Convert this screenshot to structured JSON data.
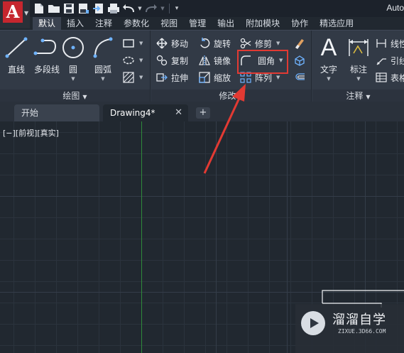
{
  "app": {
    "title": "Auto",
    "logo_letter": "A"
  },
  "ribbon_tabs": [
    {
      "label": "默认",
      "active": true
    },
    {
      "label": "插入"
    },
    {
      "label": "注释"
    },
    {
      "label": "参数化"
    },
    {
      "label": "视图"
    },
    {
      "label": "管理"
    },
    {
      "label": "输出"
    },
    {
      "label": "附加模块"
    },
    {
      "label": "协作"
    },
    {
      "label": "精选应用"
    }
  ],
  "draw_panel": {
    "title": "绘图",
    "tools": {
      "line": "直线",
      "polyline": "多段线",
      "circle": "圆",
      "arc": "圆弧"
    }
  },
  "modify_panel": {
    "title": "修改",
    "tools": {
      "move": "移动",
      "rotate": "旋转",
      "trim": "修剪",
      "copy": "复制",
      "mirror": "镜像",
      "fillet": "圆角",
      "stretch": "拉伸",
      "scale": "缩放",
      "array": "阵列"
    }
  },
  "annotation_panel": {
    "title": "注释",
    "tools": {
      "text": "文字",
      "dimension": "标注",
      "linear": "线性",
      "leader": "引线",
      "table": "表格"
    }
  },
  "doc_tabs": {
    "start": "开始",
    "drawing": "Drawing4*"
  },
  "viewport_label": "[−][前视][真实]",
  "watermark": {
    "title": "溜溜自学",
    "url": "ZIXUE.3D66.COM"
  },
  "colors": {
    "accent_red": "#e23a33",
    "canvas": "#212830",
    "ribbon": "#323a46"
  }
}
